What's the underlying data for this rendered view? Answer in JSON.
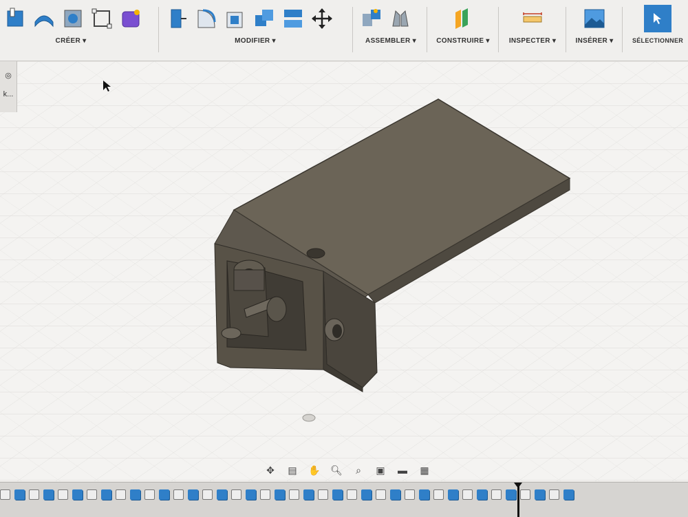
{
  "toolbar": {
    "groups": [
      {
        "label": "CRÉER ▾"
      },
      {
        "label": "MODIFIER ▾"
      },
      {
        "label": "ASSEMBLER ▾"
      },
      {
        "label": "CONSTRUIRE ▾"
      },
      {
        "label": "INSPECTER ▾"
      },
      {
        "label": "INSÉRER ▾"
      },
      {
        "label": "SÉLECTIONNER"
      }
    ]
  },
  "colors": {
    "accent": "#2f7fc8",
    "model": "#6b6457",
    "grid": "#d7d6d3"
  },
  "left_panel": {
    "items": [
      {
        "icon": "circle-icon",
        "text": "●"
      },
      {
        "icon": "target-icon",
        "text": "◎"
      },
      {
        "icon": "text",
        "text": "k..."
      }
    ]
  },
  "nav_icons": [
    {
      "icon": "orbit-icon",
      "glyph": "✥"
    },
    {
      "icon": "look-icon",
      "glyph": "▤"
    },
    {
      "icon": "pan-icon",
      "glyph": "✋"
    },
    {
      "icon": "zoom-icon",
      "glyph": "🔍︎"
    },
    {
      "icon": "fit-icon",
      "glyph": "⌕"
    },
    {
      "icon": "display-settings-icon",
      "glyph": "▣"
    },
    {
      "icon": "visual-style-icon",
      "glyph": "▬"
    },
    {
      "icon": "viewports-icon",
      "glyph": "▦"
    }
  ]
}
